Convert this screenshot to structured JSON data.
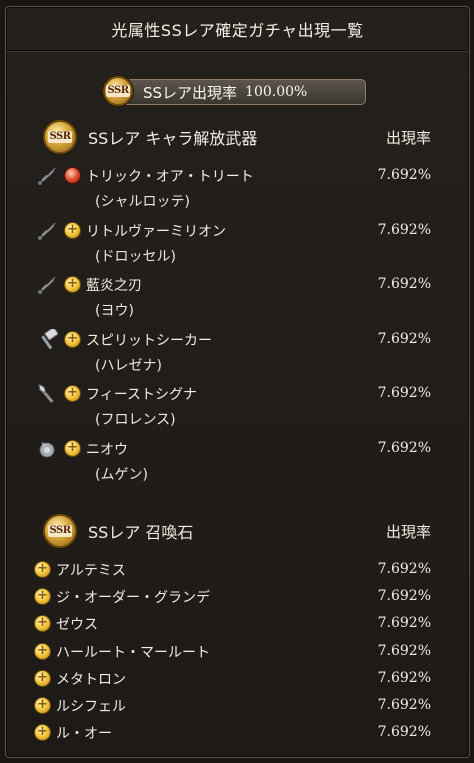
{
  "window": {
    "title": "光属性SSレア確定ガチャ出現一覧"
  },
  "banner": {
    "label": "SSレア出現率",
    "value": "100.00%",
    "badge_text": "SSR"
  },
  "weapons_section": {
    "title": "SSレア キャラ解放武器",
    "rate_header": "出現率",
    "badge_text": "SSR",
    "items": [
      {
        "name": "トリック・オア・トリート",
        "character": "(シャルロッテ)",
        "rate": "7.692%",
        "weapon_icon": "sword-icon",
        "element": "fire"
      },
      {
        "name": "リトルヴァーミリオン",
        "character": "(ドロッセル)",
        "rate": "7.692%",
        "weapon_icon": "sword-icon",
        "element": "light"
      },
      {
        "name": "藍炎之刃",
        "character": "(ヨウ)",
        "rate": "7.692%",
        "weapon_icon": "sword-icon",
        "element": "light"
      },
      {
        "name": "スピリットシーカー",
        "character": "(ハレゼナ)",
        "rate": "7.692%",
        "weapon_icon": "hammer-icon",
        "element": "light"
      },
      {
        "name": "フィーストシグナ",
        "character": "(フロレンス)",
        "rate": "7.692%",
        "weapon_icon": "axe-icon",
        "element": "light"
      },
      {
        "name": "ニオウ",
        "character": "(ムゲン)",
        "rate": "7.692%",
        "weapon_icon": "gauntlet-icon",
        "element": "light"
      }
    ]
  },
  "summons_section": {
    "title": "SSレア 召喚石",
    "rate_header": "出現率",
    "badge_text": "SSR",
    "items": [
      {
        "name": "アルテミス",
        "rate": "7.692%",
        "element": "light"
      },
      {
        "name": "ジ・オーダー・グランデ",
        "rate": "7.692%",
        "element": "light"
      },
      {
        "name": "ゼウス",
        "rate": "7.692%",
        "element": "light"
      },
      {
        "name": "ハールート・マールート",
        "rate": "7.692%",
        "element": "light"
      },
      {
        "name": "メタトロン",
        "rate": "7.692%",
        "element": "light"
      },
      {
        "name": "ルシフェル",
        "rate": "7.692%",
        "element": "light"
      },
      {
        "name": "ル・オー",
        "rate": "7.692%",
        "element": "light"
      }
    ]
  }
}
